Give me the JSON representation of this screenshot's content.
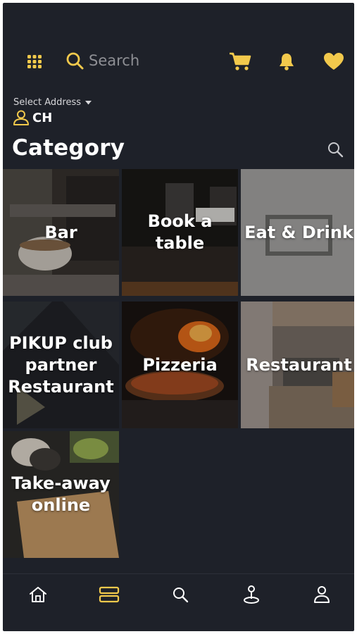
{
  "header": {
    "search_placeholder": "Search",
    "icons": [
      "grid-icon",
      "search-icon",
      "cart-icon",
      "bell-icon",
      "heart-icon"
    ]
  },
  "address": {
    "label": "Select Address",
    "value": "CH"
  },
  "category": {
    "title": "Category",
    "tiles": [
      {
        "label": "Bar"
      },
      {
        "label": "Book a table"
      },
      {
        "label": "Eat & Drink"
      },
      {
        "label": "PIKUP club partner Restaurant"
      },
      {
        "label": "Pizzeria"
      },
      {
        "label": "Restaurant"
      },
      {
        "label": "Take-away online"
      }
    ]
  },
  "bottom_nav": [
    "home-icon",
    "categories-icon",
    "search-icon",
    "map-pin-icon",
    "profile-icon"
  ],
  "colors": {
    "background": "#1e2129",
    "accent": "#f2c94c",
    "text": "#ffffff"
  }
}
